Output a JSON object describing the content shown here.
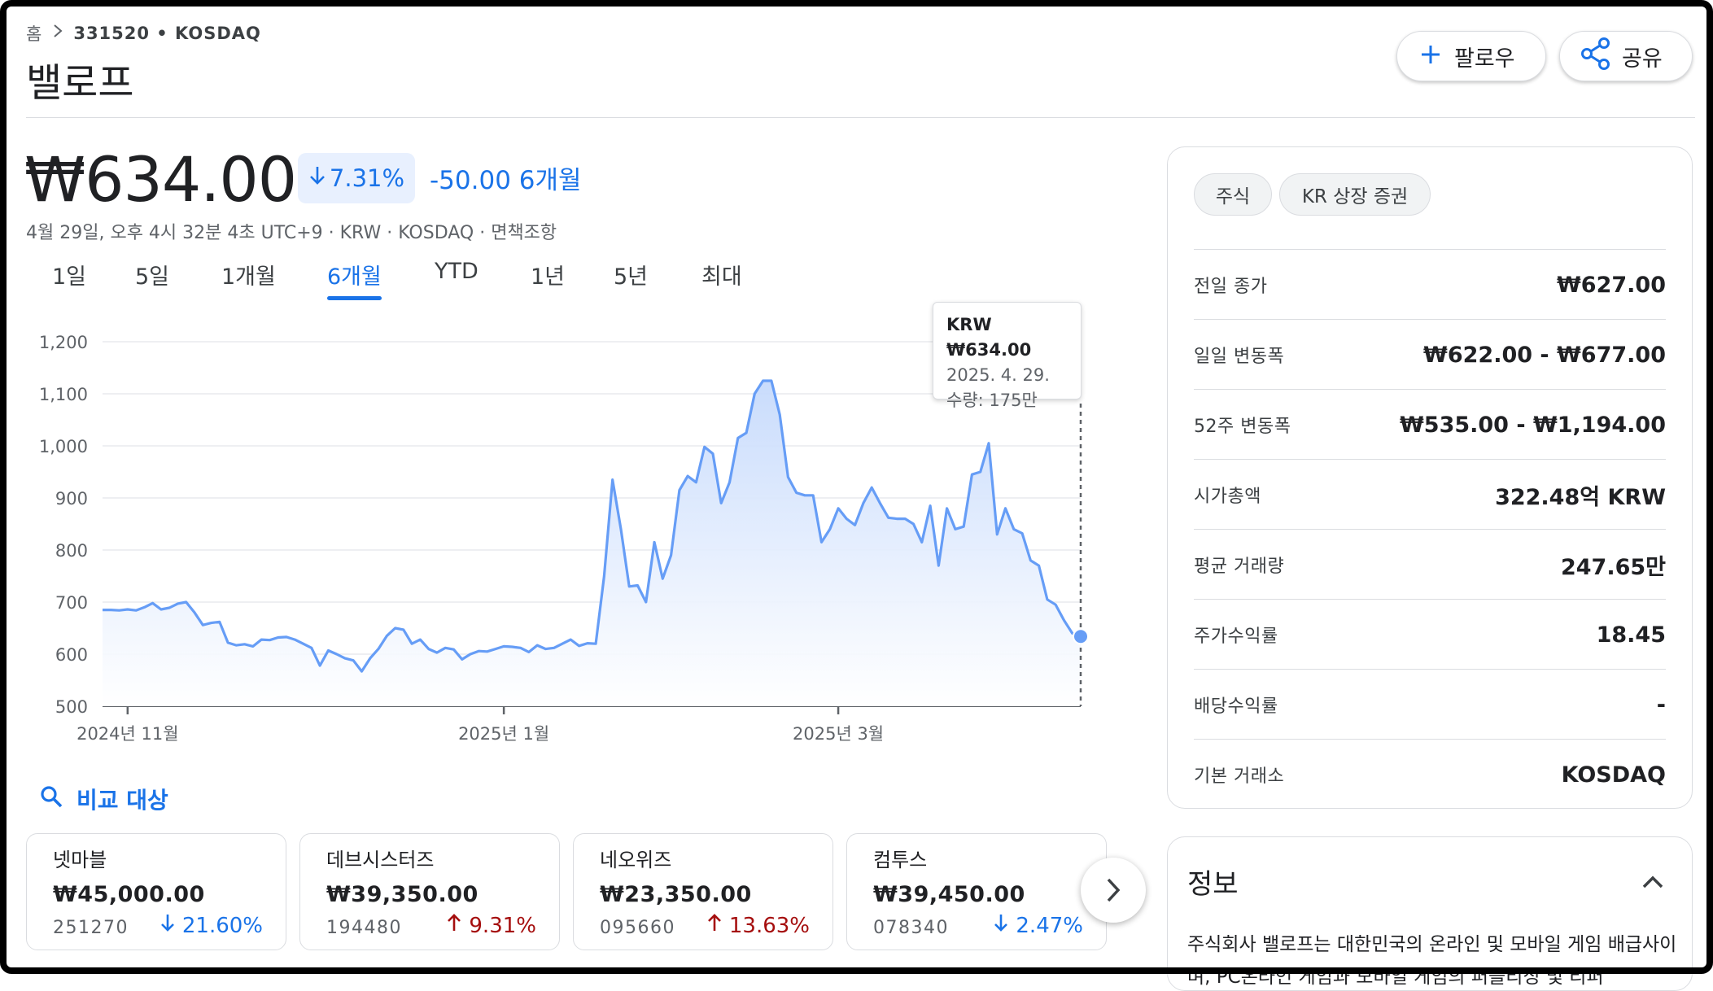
{
  "breadcrumb": {
    "home": "홈",
    "symbol": "331520 • KOSDAQ"
  },
  "title": "밸로프",
  "header_buttons": {
    "follow": "팔로우",
    "share": "공유"
  },
  "quote": {
    "price": "₩634.00",
    "change_pct": "7.31%",
    "change_abs": "-50.00 6개월",
    "meta": "4월 29일, 오후 4시 32분 4초 UTC+9 · KRW · KOSDAQ · 면책조항"
  },
  "tabs": [
    {
      "label": "1일",
      "active": false
    },
    {
      "label": "5일",
      "active": false
    },
    {
      "label": "1개월",
      "active": false
    },
    {
      "label": "6개월",
      "active": true
    },
    {
      "label": "YTD",
      "active": false
    },
    {
      "label": "1년",
      "active": false
    },
    {
      "label": "5년",
      "active": false
    },
    {
      "label": "최대",
      "active": false
    }
  ],
  "tooltip": {
    "line1": "KRW ₩634.00",
    "line2": "2025. 4. 29.",
    "line3": "수량: 175만"
  },
  "chart_data": {
    "type": "area",
    "ylim": [
      500,
      1200
    ],
    "yticks": [
      "1,200",
      "1,100",
      "1,000",
      "900",
      "800",
      "700",
      "600",
      "500"
    ],
    "xticks": [
      "2024년 11월",
      "2025년 1월",
      "2025년 3월"
    ],
    "grid": true,
    "color": "#669df6",
    "series": [
      {
        "values": [
          685,
          685,
          684,
          686,
          684,
          690,
          698,
          686,
          689,
          697,
          700,
          680,
          656,
          660,
          662,
          622,
          617,
          619,
          615,
          628,
          627,
          632,
          633,
          628,
          620,
          612,
          578,
          607,
          600,
          592,
          588,
          567,
          592,
          610,
          635,
          650,
          647,
          620,
          628,
          610,
          603,
          612,
          609,
          590,
          600,
          606,
          605,
          610,
          615,
          614,
          612,
          604,
          617,
          610,
          612,
          620,
          628,
          616,
          621,
          620,
          750,
          935,
          840,
          730,
          732,
          700,
          815,
          745,
          790,
          915,
          942,
          930,
          998,
          985,
          890,
          930,
          1015,
          1025,
          1100,
          1125,
          1125,
          1060,
          940,
          910,
          905,
          905,
          815,
          840,
          880,
          860,
          848,
          890,
          920,
          890,
          862,
          860,
          860,
          850,
          815,
          885,
          770,
          880,
          840,
          845,
          945,
          950,
          1005,
          830,
          880,
          840,
          832,
          780,
          770,
          705,
          695,
          665,
          640,
          634
        ]
      }
    ]
  },
  "compare": {
    "label": "비교 대상"
  },
  "peers": [
    {
      "name": "넷마블",
      "price": "₩45,000.00",
      "code": "251270",
      "change": "21.60%",
      "direction": "down"
    },
    {
      "name": "데브시스터즈",
      "price": "₩39,350.00",
      "code": "194480",
      "change": "9.31%",
      "direction": "up"
    },
    {
      "name": "네오위즈",
      "price": "₩23,350.00",
      "code": "095660",
      "change": "13.63%",
      "direction": "up"
    },
    {
      "name": "컴투스",
      "price": "₩39,450.00",
      "code": "078340",
      "change": "2.47%",
      "direction": "down"
    }
  ],
  "panel": {
    "chips": [
      "주식",
      "KR 상장 증권"
    ],
    "stats": [
      {
        "label": "전일 종가",
        "value": "₩627.00"
      },
      {
        "label": "일일 변동폭",
        "value": "₩622.00 - ₩677.00"
      },
      {
        "label": "52주 변동폭",
        "value": "₩535.00 - ₩1,194.00"
      },
      {
        "label": "시가총액",
        "value": "322.48억 KRW"
      },
      {
        "label": "평균 거래량",
        "value": "247.65만"
      },
      {
        "label": "주가수익률",
        "value": "18.45"
      },
      {
        "label": "배당수익률",
        "value": "-"
      },
      {
        "label": "기본 거래소",
        "value": "KOSDAQ"
      }
    ]
  },
  "about": {
    "title": "정보",
    "text": "주식회사 밸로프는 대한민국의 온라인 및 모바일 게임 배급사이며, PC온라인 게임과 모바일 게임의 퍼블리싱 및 리퍼"
  },
  "icons": {
    "arrow_down": "arrow-down-icon",
    "arrow_up": "arrow-up-icon",
    "search": "search-icon",
    "share": "share-icon",
    "plus": "plus-icon",
    "chevron_right": "chevron-right-icon",
    "chevron_up": "chevron-up-icon"
  }
}
